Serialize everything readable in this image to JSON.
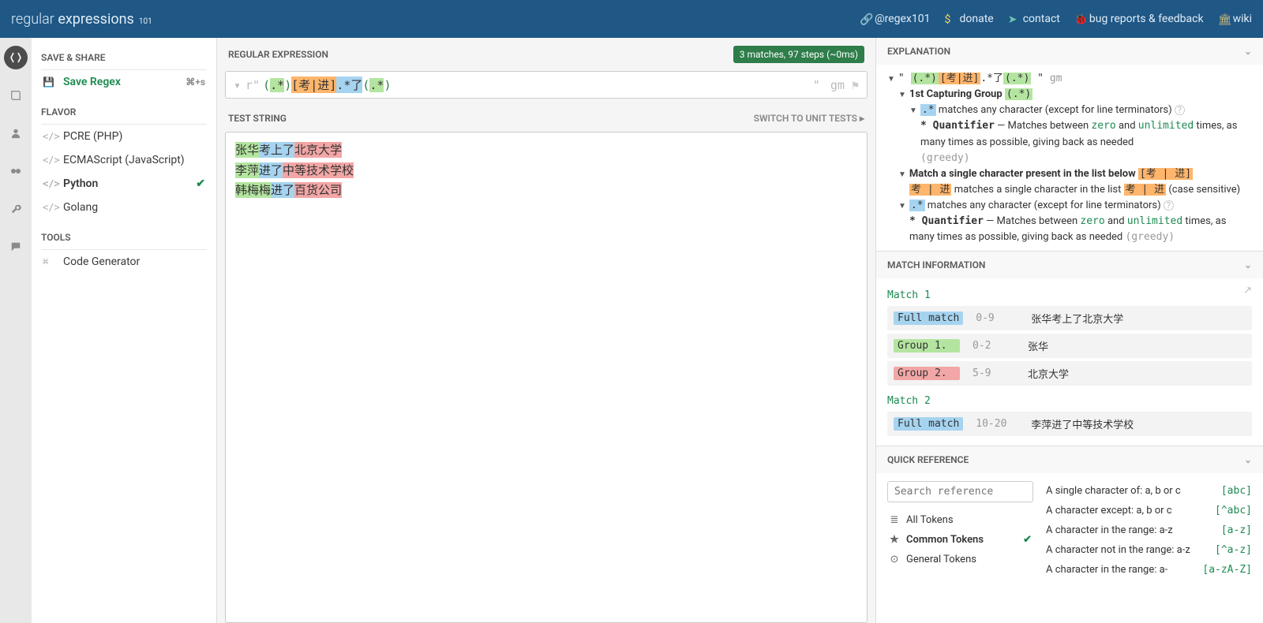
{
  "brand": {
    "a": "regular",
    "b": "expressions",
    "sub": "101"
  },
  "header_links": [
    {
      "icon": "link-icon",
      "label": "@regex101"
    },
    {
      "icon": "dollar-icon",
      "label": "donate"
    },
    {
      "icon": "send-icon",
      "label": "contact"
    },
    {
      "icon": "bug-icon",
      "label": "bug reports & feedback"
    },
    {
      "icon": "book-icon",
      "label": "wiki"
    }
  ],
  "sidebar": {
    "save_share": "SAVE & SHARE",
    "save_regex": "Save Regex",
    "save_shortcut": "⌘+s",
    "flavor": "FLAVOR",
    "flavors": [
      {
        "label": "PCRE (PHP)",
        "sel": false
      },
      {
        "label": "ECMAScript (JavaScript)",
        "sel": false
      },
      {
        "label": "Python",
        "sel": true
      },
      {
        "label": "Golang",
        "sel": false
      }
    ],
    "tools": "TOOLS",
    "code_gen": "Code Generator"
  },
  "center": {
    "regex_title": "REGULAR EXPRESSION",
    "status_badge": "3 matches, 97 steps (~0ms)",
    "prefix": "r\"",
    "g1_open": "(",
    "g1_body": ".*",
    "g1_close": ")",
    "class": "[考|进]",
    "mid": ".*了",
    "g2_open": "(",
    "g2_body": ".*",
    "g2_close": ")",
    "suffix": "\"",
    "flags": "gm",
    "test_title": "TEST STRING",
    "switch_link": "SWITCH TO UNIT TESTS ▸",
    "tests": [
      {
        "g1": "张华",
        "mid": "考上了",
        "g2": "北京大学"
      },
      {
        "g1": "李萍",
        "mid": "进了",
        "g2": "中等技术学校"
      },
      {
        "g1": "韩梅梅",
        "mid": "进了",
        "g2": "百货公司"
      }
    ]
  },
  "explanation": {
    "title": "EXPLANATION",
    "root_pre": "\" ",
    "root_body": "(.*)[考|进].*了(.*)",
    "root_post": " \"",
    "root_flags": "gm",
    "l1": "1st Capturing Group ",
    "l1_tok": "(.*)",
    "l2_a": ".*",
    "l2_b": " matches any character (except for line terminators) ",
    "l3_a": "* Quantifier",
    "l3_b": " — Matches between ",
    "l3_c": "zero",
    "l3_d": " and ",
    "l3_e": "unlimited",
    "l3_f": " times, as many times as possible, giving back as needed ",
    "l3_g": "(greedy)",
    "l4_a": "Match a single character present in the list below ",
    "l4_b": "[考 | 进]",
    "l5_a": "考 | 进",
    "l5_b": " matches a single character in the list ",
    "l5_c": "考 | 进",
    "l5_d": " (case sensitive)",
    "l6_a": ".*",
    "l6_b": " matches any character (except for line terminators) ",
    "l7_a": "* Quantifier",
    "l7_b": " — Matches between ",
    "l7_c": "zero",
    "l7_d": " and ",
    "l7_e": "unlimited",
    "l7_f": " times, as many times as possible, giving back as needed ",
    "l7_g": "(greedy)"
  },
  "match_info": {
    "title": "MATCH INFORMATION",
    "m1": "Match 1",
    "rows1": [
      {
        "tag": "Full match",
        "cls": "full",
        "range": "0-9",
        "val": "张华考上了北京大学"
      },
      {
        "tag": "Group 1.",
        "cls": "g1",
        "range": "0-2",
        "val": "张华"
      },
      {
        "tag": "Group 2.",
        "cls": "g2",
        "range": "5-9",
        "val": "北京大学"
      }
    ],
    "m2": "Match 2",
    "rows2": [
      {
        "tag": "Full match",
        "cls": "full",
        "range": "10-20",
        "val": "李萍进了中等技术学校"
      }
    ]
  },
  "quickref": {
    "title": "QUICK REFERENCE",
    "search_ph": "Search reference",
    "cats": [
      {
        "icon": "≣",
        "label": "All Tokens",
        "sel": false
      },
      {
        "icon": "★",
        "label": "Common Tokens",
        "sel": true
      },
      {
        "icon": "⊙",
        "label": "General Tokens",
        "sel": false
      }
    ],
    "entries": [
      {
        "desc": "A single character of: a, b or c",
        "code": "[abc]"
      },
      {
        "desc": "A character except: a, b or c",
        "code": "[^abc]"
      },
      {
        "desc": "A character in the range: a-z",
        "code": "[a-z]"
      },
      {
        "desc": "A character not in the range: a-z",
        "code": "[^a-z]"
      },
      {
        "desc": "A character in the range: a-",
        "code": "[a-zA-Z]"
      }
    ]
  }
}
